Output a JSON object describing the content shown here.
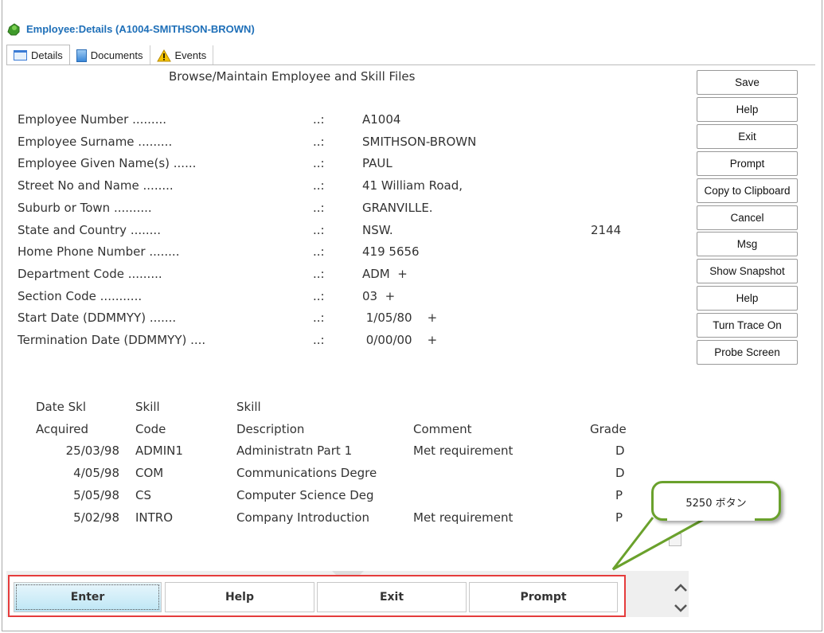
{
  "window": {
    "title": "Employee:Details (A1004-SMITHSON-BROWN)"
  },
  "tabs": [
    {
      "label": "Details",
      "icon": "window-icon"
    },
    {
      "label": "Documents",
      "icon": "document-icon"
    },
    {
      "label": "Events",
      "icon": "warning-icon"
    }
  ],
  "form": {
    "heading": "Browse/Maintain Employee and Skill Files",
    "fields": [
      {
        "label": "Employee Number .........",
        "sep": "..:",
        "value": "A1004"
      },
      {
        "label": "Employee Surname .........",
        "sep": "..:",
        "value": "SMITHSON-BROWN"
      },
      {
        "label": "Employee Given Name(s) ......",
        "sep": "..:",
        "value": "PAUL"
      },
      {
        "label": "Street No and Name ........",
        "sep": "..:",
        "value": "41 William Road,"
      },
      {
        "label": "Suburb or Town ..........",
        "sep": "..:",
        "value": "GRANVILLE."
      },
      {
        "label": "State and Country ........",
        "sep": "..:",
        "value": "NSW.",
        "extra": "2144"
      },
      {
        "label": "Home Phone Number ........",
        "sep": "..:",
        "value": "419 5656"
      },
      {
        "label": "Department Code .........",
        "sep": "..:",
        "value": "ADM  +"
      },
      {
        "label": "Section Code ...........",
        "sep": "..:",
        "value": "03  +"
      },
      {
        "label": "Start Date (DDMMYY) .......",
        "sep": "..:",
        "value": " 1/05/80    +"
      },
      {
        "label": "Termination Date (DDMMYY) ....",
        "sep": "..:",
        "value": " 0/00/00    +"
      }
    ]
  },
  "side_buttons": [
    "Save",
    "Help",
    "Exit",
    "Prompt",
    "Copy to Clipboard",
    "Cancel",
    "Msg",
    "Show Snapshot",
    "Help",
    "Turn Trace On",
    "Probe Screen"
  ],
  "skills": {
    "header1": [
      "Date Skl",
      "Skill",
      "Skill",
      "",
      ""
    ],
    "header2": [
      "Acquired",
      "Code",
      "Description",
      "Comment",
      "Grade"
    ],
    "rows": [
      [
        "25/03/98",
        "ADMIN1",
        "Administratn Part 1",
        "Met requirement",
        "D"
      ],
      [
        "4/05/98",
        "COM",
        "Communications Degre",
        "",
        "D"
      ],
      [
        "5/05/98",
        "CS",
        "Computer Science Deg",
        "",
        "P"
      ],
      [
        "5/02/98",
        "INTRO",
        "Company Introduction",
        "Met requirement",
        "P"
      ]
    ]
  },
  "function_keys": [
    "Enter",
    "Help",
    "Exit",
    "Prompt"
  ],
  "callout": "5250 ボタン"
}
